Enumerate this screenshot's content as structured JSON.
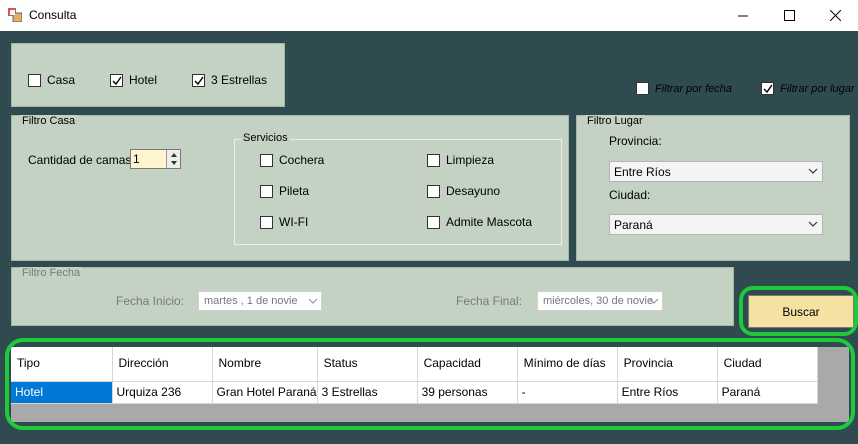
{
  "window": {
    "title": "Consulta"
  },
  "types": {
    "casa": {
      "label": "Casa",
      "checked": false
    },
    "hotel": {
      "label": "Hotel",
      "checked": true
    },
    "tres_estrellas": {
      "label": "3 Estrellas",
      "checked": true
    }
  },
  "filters_top": {
    "por_fecha": {
      "label": "Filtrar por fecha",
      "checked": false
    },
    "por_lugar": {
      "label": "Filtrar por lugar",
      "checked": true
    }
  },
  "filtro_casa": {
    "title": "Filtro Casa",
    "camas_label": "Cantidad de camas",
    "camas_value": "1",
    "servicios_title": "Servicios",
    "servicios": {
      "cochera": "Cochera",
      "limpieza": "Limpieza",
      "pileta": "Pileta",
      "desayuno": "Desayuno",
      "wifi": "WI-FI",
      "mascota": "Admite Mascota"
    }
  },
  "filtro_lugar": {
    "title": "Filtro Lugar",
    "provincia_label": "Provincia:",
    "provincia_value": "Entre Ríos",
    "ciudad_label": "Ciudad:",
    "ciudad_value": "Paraná"
  },
  "filtro_fecha": {
    "title": "Filtro Fecha",
    "inicio_label": "Fecha Inicio:",
    "inicio_value": "martes   ,   1 de novie",
    "final_label": "Fecha Final:",
    "final_value": "miércoles, 30 de novie"
  },
  "buscar_label": "Buscar",
  "grid": {
    "headers": {
      "tipo": "Tipo",
      "direccion": "Dirección",
      "nombre": "Nombre",
      "status": "Status",
      "capacidad": "Capacidad",
      "minimo": "Mínimo de días",
      "provincia": "Provincia",
      "ciudad": "Ciudad"
    },
    "row0": {
      "tipo": "Hotel",
      "direccion": "Urquiza 236",
      "nombre": "Gran Hotel Paraná",
      "status": "3 Estrellas",
      "capacidad": "39 personas",
      "minimo": "-",
      "provincia": "Entre Ríos",
      "ciudad": "Paraná"
    }
  },
  "colors": {
    "panel": "#c4d2c4",
    "background": "#2f4b50",
    "button": "#f5e2a2",
    "highlight": "#1ec93c",
    "selection": "#0078d7"
  }
}
